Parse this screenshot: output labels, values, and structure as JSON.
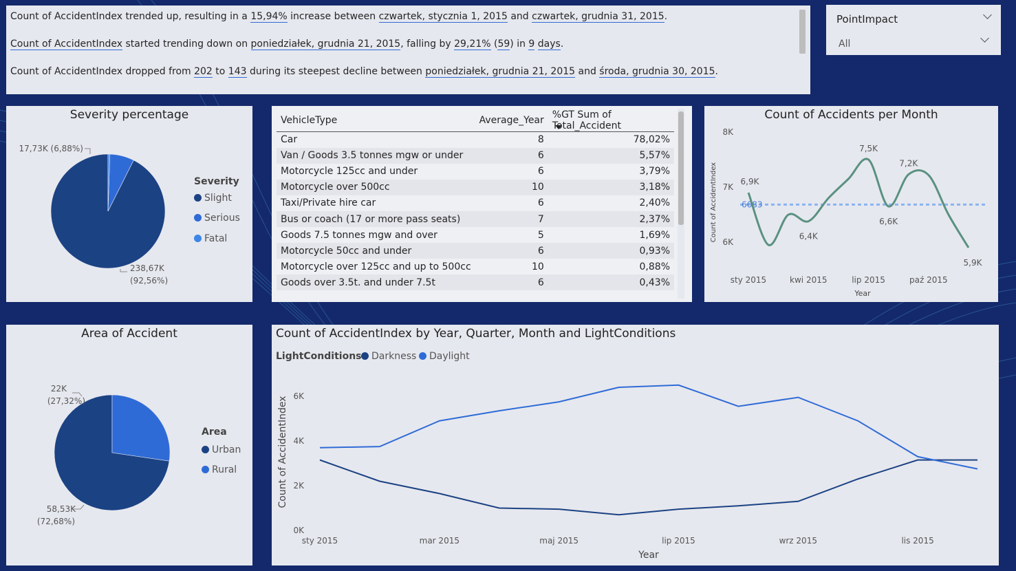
{
  "narrative": {
    "line1": {
      "p1": "Count of AccidentIndex trended up, resulting in a ",
      "v1": "15,94%",
      "p2": " increase between ",
      "v2": "czwartek, stycznia 1, 2015",
      "p3": " and ",
      "v3": "czwartek, grudnia 31, 2015",
      "p4": "."
    },
    "line2": {
      "v1": "Count of AccidentIndex",
      "p1": " started trending down on ",
      "v2": "poniedziałek, grudnia 21, 2015",
      "p2": ", falling by ",
      "v3": "29,21%",
      "p3": " (",
      "v4": "59",
      "p4": ") in ",
      "v5": "9",
      "p5": " ",
      "v6": "days",
      "p6": "."
    },
    "line3": {
      "p1": "Count of AccidentIndex dropped from ",
      "v1": "202",
      "p2": " to ",
      "v2": "143",
      "p3": " during its steepest decline between ",
      "v3": "poniedziałek, grudnia 21, 2015",
      "p4": " and ",
      "v4": "środa, grudnia 30, 2015",
      "p5": "."
    }
  },
  "slicer": {
    "title": "PointImpact",
    "value": "All"
  },
  "colors": {
    "dark_blue": "#1b4283",
    "mid_blue": "#2f6bd6",
    "light_blue": "#3d86e8",
    "teal": "#5a9181",
    "avg_line": "#8ab4f0",
    "background": "#14296b"
  },
  "severity": {
    "title": "Severity percentage",
    "legend_title": "Severity",
    "labels": {
      "slight": "238,67K",
      "slight_pct": "(92,56%)",
      "serious": "17,73K (6,88%)"
    }
  },
  "area": {
    "title": "Area of Accident",
    "legend_title": "Area",
    "labels": {
      "urban": "58,53K",
      "urban_pct": "(72,68%)",
      "rural": "22K",
      "rural_pct": "(27,32%)"
    }
  },
  "vehicle_table": {
    "columns": [
      "VehicleType",
      "Average_Year",
      "%GT Sum of Total_Accident"
    ],
    "rows": [
      [
        "Car",
        "8",
        "78,02%"
      ],
      [
        "Van / Goods 3.5 tonnes mgw or under",
        "6",
        "5,57%"
      ],
      [
        "Motorcycle 125cc and under",
        "6",
        "3,79%"
      ],
      [
        "Motorcycle over 500cc",
        "10",
        "3,18%"
      ],
      [
        "Taxi/Private hire car",
        "6",
        "2,40%"
      ],
      [
        "Bus or coach (17 or more pass seats)",
        "7",
        "2,37%"
      ],
      [
        "Goods 7.5 tonnes mgw and over",
        "5",
        "1,69%"
      ],
      [
        "Motorcycle 50cc and under",
        "6",
        "0,93%"
      ],
      [
        "Motorcycle over 125cc and up to 500cc",
        "10",
        "0,88%"
      ],
      [
        "Goods over 3.5t. and under 7.5t",
        "6",
        "0,43%"
      ]
    ]
  },
  "chart_data": [
    {
      "id": "severity",
      "type": "pie",
      "title": "Severity percentage",
      "legend_title": "Severity",
      "labels": [
        "Slight",
        "Serious",
        "Fatal"
      ],
      "values": [
        238670,
        17730,
        1380
      ],
      "colors": [
        "#1b4283",
        "#2f6bd6",
        "#3d86e8"
      ]
    },
    {
      "id": "area",
      "type": "pie",
      "title": "Area of Accident",
      "legend_title": "Area",
      "labels": [
        "Urban",
        "Rural"
      ],
      "values": [
        58530,
        22000
      ],
      "colors": [
        "#1b4283",
        "#2f6bd6"
      ]
    },
    {
      "id": "monthly",
      "type": "line",
      "title": "Count of Accidents per Month",
      "xlabel": "Year",
      "ylabel": "Count of AccidentIndex",
      "ylim": [
        5800,
        8000
      ],
      "yticks": [
        "6K",
        "7K",
        "8K"
      ],
      "ytick_values": [
        6000,
        7000,
        8000
      ],
      "xticks": [
        "sty 2015",
        "kwi 2015",
        "lip 2015",
        "paź 2015"
      ],
      "xtick_index": [
        0,
        3,
        6,
        9
      ],
      "x": [
        "sty 2015",
        "lut 2015",
        "mar 2015",
        "kwi 2015",
        "maj 2015",
        "cze 2015",
        "lip 2015",
        "sie 2015",
        "wrz 2015",
        "paź 2015",
        "lis 2015",
        "gru 2015"
      ],
      "values": [
        6900,
        5950,
        6500,
        6380,
        6800,
        7150,
        7500,
        6650,
        7230,
        7220,
        6500,
        5900
      ],
      "data_labels": [
        {
          "index": 0,
          "text": "6,9K"
        },
        {
          "index": 3,
          "text": "6,4K"
        },
        {
          "index": 6,
          "text": "7,5K"
        },
        {
          "index": 7,
          "text": "6,6K"
        },
        {
          "index": 8,
          "text": "7,2K"
        },
        {
          "index": 11,
          "text": "5,9K"
        }
      ],
      "average": 6683,
      "average_label": "6683",
      "color": "#5a9181"
    },
    {
      "id": "lightconditions",
      "type": "line",
      "title": "Count of AccidentIndex by Year, Quarter, Month and LightConditions",
      "xlabel": "Year",
      "ylabel": "Count of AccidentIndex",
      "legend_title": "LightConditions",
      "ylim": [
        0,
        7000
      ],
      "yticks": [
        "0K",
        "2K",
        "4K",
        "6K"
      ],
      "ytick_values": [
        0,
        2000,
        4000,
        6000
      ],
      "xticks": [
        "sty 2015",
        "mar 2015",
        "maj 2015",
        "lip 2015",
        "wrz 2015",
        "lis 2015"
      ],
      "xtick_index": [
        0,
        2,
        4,
        6,
        8,
        10
      ],
      "x": [
        "sty 2015",
        "lut 2015",
        "mar 2015",
        "kwi 2015",
        "maj 2015",
        "cze 2015",
        "lip 2015",
        "sie 2015",
        "wrz 2015",
        "paź 2015",
        "lis 2015",
        "gru 2015"
      ],
      "series": [
        {
          "name": "Darkness",
          "color": "#1b4283",
          "values": [
            3150,
            2200,
            1650,
            1000,
            950,
            700,
            950,
            1100,
            1300,
            2300,
            3150,
            3150
          ]
        },
        {
          "name": "Daylight",
          "color": "#2f6bd6",
          "values": [
            3700,
            3750,
            4900,
            5350,
            5750,
            6400,
            6500,
            5550,
            5950,
            4900,
            3300,
            2750
          ]
        }
      ]
    }
  ]
}
